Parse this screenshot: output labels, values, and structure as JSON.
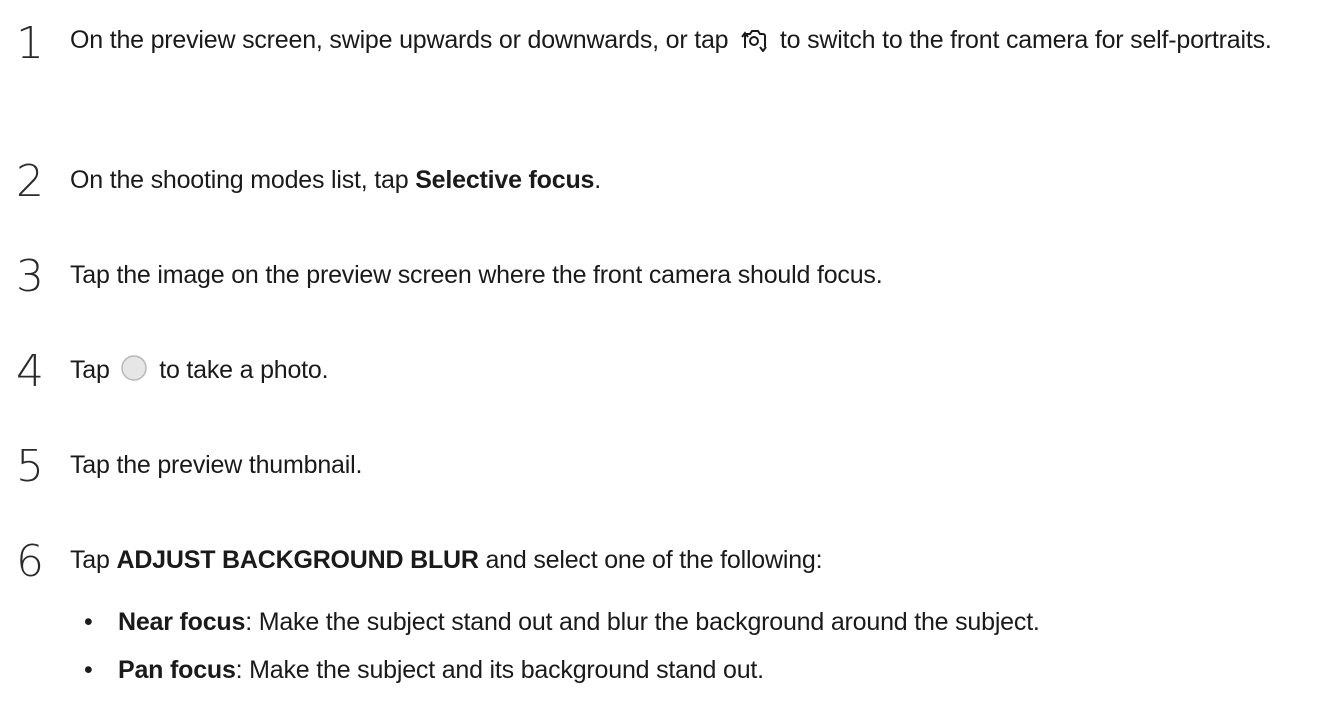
{
  "steps": [
    {
      "number": "1",
      "text_before_icon": "On the preview screen, swipe upwards or downwards, or tap",
      "icon": "switch-camera-icon",
      "text_after_icon": "to switch to the front camera for self-portraits."
    },
    {
      "number": "2",
      "text_before": "On the shooting modes list, tap ",
      "bold": "Selective focus",
      "text_after": "."
    },
    {
      "number": "3",
      "text": "Tap the image on the preview screen where the front camera should focus."
    },
    {
      "number": "4",
      "text_before_icon": "Tap",
      "icon": "shutter-button-icon",
      "text_after_icon": "to take a photo."
    },
    {
      "number": "5",
      "text": "Tap the preview thumbnail."
    },
    {
      "number": "6",
      "text_before": "Tap ",
      "bold": "ADJUST BACKGROUND BLUR",
      "text_after": " and select one of the following:"
    }
  ],
  "options": [
    {
      "bullet": "•",
      "label": "Near focus",
      "description": ": Make the subject stand out and blur the background around the subject."
    },
    {
      "bullet": "•",
      "label": "Pan focus",
      "description": ": Make the subject and its background stand out."
    }
  ]
}
